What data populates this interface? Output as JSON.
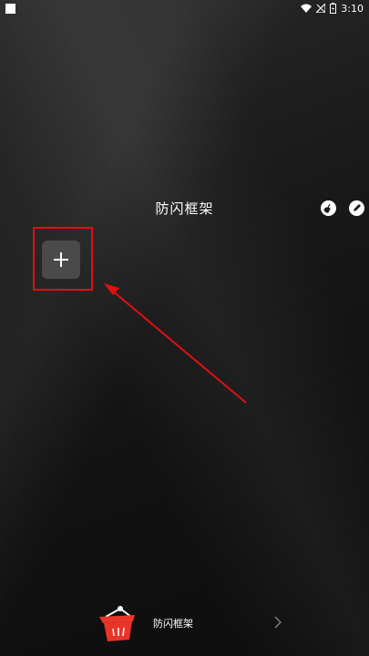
{
  "status_bar": {
    "time": "3:10",
    "icons": [
      "square-icon",
      "wifi-icon",
      "no-signal-icon",
      "battery-icon"
    ]
  },
  "header": {
    "title": "防闪框架",
    "icons": [
      "cleaner-icon",
      "pencil-icon"
    ]
  },
  "main": {
    "add_button_icon": "plus-icon",
    "highlight_color": "#e01010",
    "arrow_color": "#e01010"
  },
  "bottom_bar": {
    "label": "防闪框架",
    "icon": "basket-icon",
    "chevron_icon": "chevron-right-icon"
  }
}
